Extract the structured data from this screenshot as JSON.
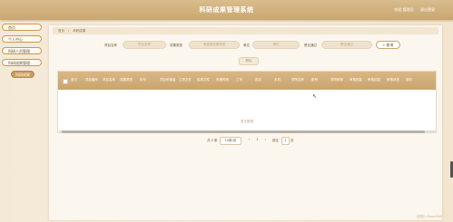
{
  "app": {
    "title": "科研成果管理系统"
  },
  "header": {
    "user_text": "欢迎 管理员",
    "logout_label": "退出登录"
  },
  "sidebar": {
    "items": [
      {
        "label": "首页"
      },
      {
        "label": "个人中心"
      },
      {
        "label": "科研人员管理"
      },
      {
        "label": "科研成果管理"
      }
    ],
    "sub_item": {
      "label": "科研成果"
    }
  },
  "breadcrumb": {
    "home": "首页",
    "current": "科研成果"
  },
  "search": {
    "fields": [
      {
        "label": "项目名称",
        "placeholder": "项目名称"
      },
      {
        "label": "成果类型",
        "placeholder": "请选择成果类型"
      },
      {
        "label": "单位",
        "placeholder": "单位"
      },
      {
        "label": "是否通过",
        "placeholder": "是否通过"
      }
    ],
    "query_label": "查询",
    "query_icon": "search-icon"
  },
  "toolbar": {
    "delete_label": "删除"
  },
  "table": {
    "columns": [
      "索引",
      "项目编号",
      "项目名称",
      "成果类型",
      "年份",
      "项目申报者",
      "立项文件",
      "结项文件",
      "申报时间",
      "工号",
      "姓名",
      "手机",
      "学院名称",
      "账号",
      "学院审核",
      "审核回复",
      "审核回复",
      "审核状态",
      "操作"
    ],
    "empty_text": "暂无数据"
  },
  "pagination": {
    "total_text": "共 0 条",
    "page_size": "10条/页",
    "prev": "‹",
    "page": "1",
    "next": "›",
    "goto_label": "前往",
    "goto_value": "1",
    "page_unit": "页"
  },
  "footer": {
    "text": "@图片 Beautifull"
  },
  "colors": {
    "accent": "#c9a46d",
    "topbar": "#d4b37f",
    "background": "#f6ecdb"
  }
}
